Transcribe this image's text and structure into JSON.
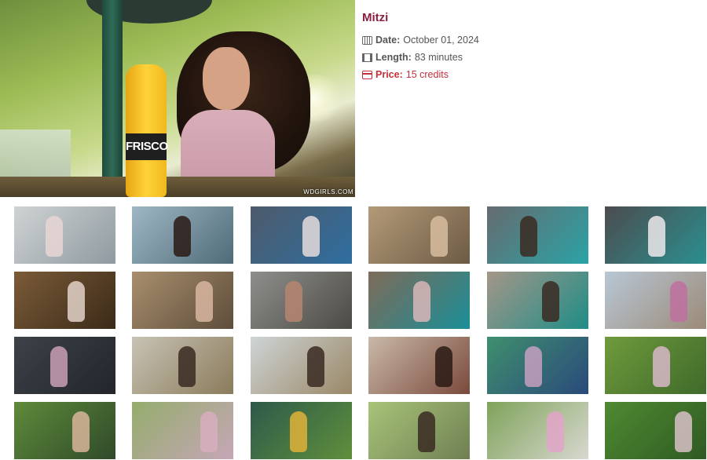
{
  "hero": {
    "bottle_text": "FRISCO",
    "watermark": "WDGIRLS.COM"
  },
  "info": {
    "title": "Mitzi",
    "date_label": "Date:",
    "date_value": "October 01, 2024",
    "length_label": "Length:",
    "length_value": "83 minutes",
    "price_label": "Price:",
    "price_value": "15 credits",
    "icons": [
      "calendar-icon",
      "film-icon",
      "credit-card-icon"
    ],
    "colors": {
      "title": "#8c1f3f",
      "price": "#c2303a",
      "text": "#555555"
    }
  },
  "thumbnails": [
    {
      "scene": "white room, posing with bottle",
      "bg": [
        "#cfd3d4",
        "#8f9aa0"
      ],
      "fig": "#e7d6d3"
    },
    {
      "scene": "drinking in bright room",
      "bg": [
        "#9fb7c4",
        "#4f6b78"
      ],
      "fig": "#2a1a14"
    },
    {
      "scene": "blue hot tub room",
      "bg": [
        "#4d5a6a",
        "#2f6ea0"
      ],
      "fig": "#e4dcdc"
    },
    {
      "scene": "stone wall crouching",
      "bg": [
        "#b39a78",
        "#6d5b45"
      ],
      "fig": "#d8bda0"
    },
    {
      "scene": "hot tub lounging",
      "bg": [
        "#666b6f",
        "#2aa3a6"
      ],
      "fig": "#3a2a22"
    },
    {
      "scene": "dark wall standing",
      "bg": [
        "#4c4c4f",
        "#2b8f8f"
      ],
      "fig": "#ece8ea"
    },
    {
      "scene": "wooden sauna room",
      "bg": [
        "#7b5b38",
        "#3b2a18"
      ],
      "fig": "#e2d2c8"
    },
    {
      "scene": "doorway standing",
      "bg": [
        "#a88e6d",
        "#5d4d3a"
      ],
      "fig": "#d9b6a0"
    },
    {
      "scene": "shower corner sitting",
      "bg": [
        "#8e8f8c",
        "#4c4a44"
      ],
      "fig": "#b58670"
    },
    {
      "scene": "pool table lying",
      "bg": [
        "#7e6a58",
        "#1b8f98"
      ],
      "fig": "#d9b6b9"
    },
    {
      "scene": "pool table with drink",
      "bg": [
        "#a49688",
        "#1e8d87"
      ],
      "fig": "#3a2a22"
    },
    {
      "scene": "street walking",
      "bg": [
        "#b8c7d5",
        "#9b8a78"
      ],
      "fig": "#c070a0"
    },
    {
      "scene": "car garage sitting",
      "bg": [
        "#3d4248",
        "#22262b"
      ],
      "fig": "#c99fb5"
    },
    {
      "scene": "cafe table",
      "bg": [
        "#c8c3b5",
        "#8a7b5a"
      ],
      "fig": "#3a2a22"
    },
    {
      "scene": "cafe window with drink",
      "bg": [
        "#ced4d6",
        "#9a8866"
      ],
      "fig": "#3a2a22"
    },
    {
      "scene": "sunglasses close-up",
      "bg": [
        "#c9b9a8",
        "#7a4a3c"
      ],
      "fig": "#2a1a14"
    },
    {
      "scene": "graffiti wall",
      "bg": [
        "#3f8f6f",
        "#2a4a7a"
      ],
      "fig": "#c6a0c0"
    },
    {
      "scene": "park hillside",
      "bg": [
        "#6f9a3c",
        "#3f6a2a"
      ],
      "fig": "#d7b7c8"
    },
    {
      "scene": "umbrella pole drinking",
      "bg": [
        "#5f8a3a",
        "#2f4a2a"
      ],
      "fig": "#d8b59a"
    },
    {
      "scene": "bending over bench",
      "bg": [
        "#94ad6b",
        "#c6a6b7"
      ],
      "fig": "#d7aebe"
    },
    {
      "scene": "umbrella with bottle",
      "bg": [
        "#2e5a4a",
        "#5f8f3c"
      ],
      "fig": "#e0b23a"
    },
    {
      "scene": "garden bench sunlight",
      "bg": [
        "#a8c479",
        "#6f7f52"
      ],
      "fig": "#3a2a22"
    },
    {
      "scene": "garden fence dancing",
      "bg": [
        "#7fa35a",
        "#d8d8d0"
      ],
      "fig": "#e2a5c8"
    },
    {
      "scene": "lawn lying near cars",
      "bg": [
        "#4f8a32",
        "#2f5a22"
      ],
      "fig": "#d8c0c8"
    }
  ]
}
